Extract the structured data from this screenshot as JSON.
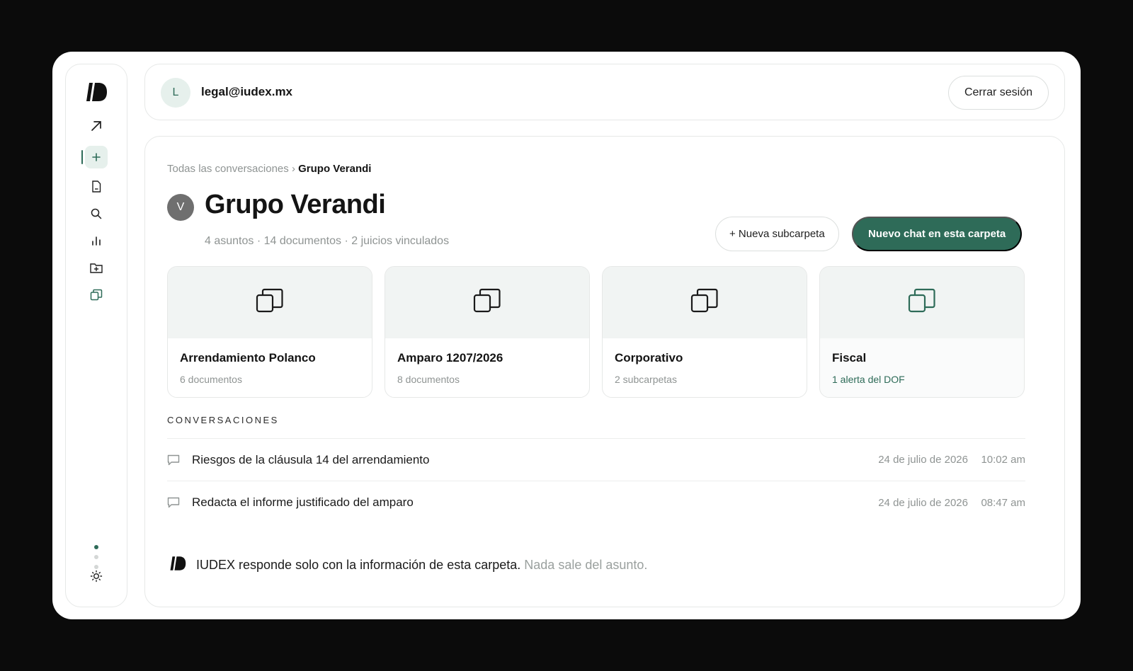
{
  "header": {
    "avatar_initial": "L",
    "email": "legal@iudex.mx",
    "logout_label": "Cerrar sesión"
  },
  "sidebar": {
    "items": [
      {
        "name": "logo-icon"
      },
      {
        "name": "arrow-up-right-icon"
      },
      {
        "name": "plus-icon",
        "active": true
      },
      {
        "name": "document-icon"
      },
      {
        "name": "search-icon"
      },
      {
        "name": "bar-chart-icon"
      },
      {
        "name": "folder-icon"
      },
      {
        "name": "folders-icon"
      },
      {
        "name": "sun-icon"
      }
    ],
    "accent": "#2e6b58"
  },
  "breadcrumb": {
    "root": "Todas las conversaciones",
    "separator": "›",
    "current": "Grupo Verandi"
  },
  "folder": {
    "avatar_initial": "V",
    "title": "Grupo Verandi",
    "meta": "4 asuntos · 14 documentos · 2 juicios vinculados"
  },
  "actions": {
    "new_subfolder": "+ Nueva subcarpeta",
    "new_chat": "Nuevo chat en esta carpeta"
  },
  "subfolders": [
    {
      "name": "Arrendamiento Polanco",
      "sub": "6 documentos"
    },
    {
      "name": "Amparo 1207/2026",
      "sub": "8 documentos"
    },
    {
      "name": "Corporativo",
      "sub": "2 subcarpetas"
    },
    {
      "name": "Fiscal",
      "sub": "1 alerta del DOF"
    }
  ],
  "conversations": {
    "heading": "CONVERSACIONES",
    "items": [
      {
        "title": "Riesgos de la cláusula 14 del arrendamiento",
        "date": "24 de julio de 2026",
        "time": "10:02 am"
      },
      {
        "title": "Redacta el informe justificado del amparo",
        "date": "24 de julio de 2026",
        "time": "08:47 am"
      }
    ]
  },
  "footer": {
    "text": "IUDEX responde solo con la información de esta carpeta.",
    "muted": "Nada sale del asunto."
  }
}
